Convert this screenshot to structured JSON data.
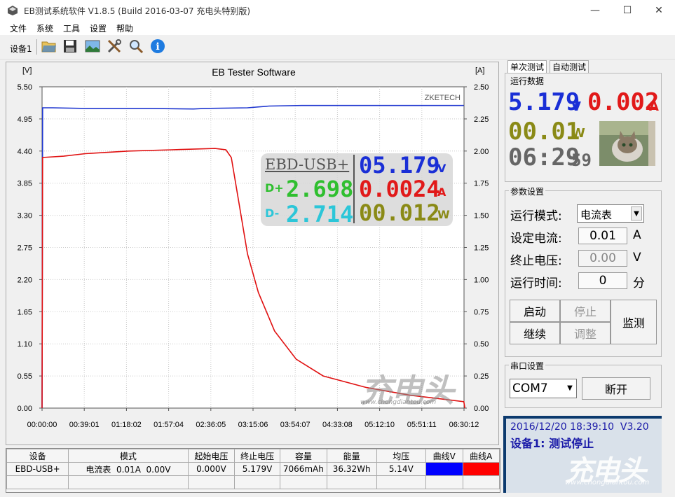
{
  "window": {
    "title": "EB测试系统软件 V1.8.5 (Build 2016-03-07 充电头特别版)",
    "min": "—",
    "max": "☐",
    "close": "✕"
  },
  "menu": [
    "文件",
    "系统",
    "工具",
    "设置",
    "帮助"
  ],
  "toolbar": {
    "device_label": "设备1",
    "icons": [
      "open-folder-icon",
      "save-icon",
      "image-icon",
      "tools-icon",
      "search-icon",
      "info-icon"
    ]
  },
  "colors": {
    "voltage": "#1f37d0",
    "current": "#e01010",
    "lcd_blue": "#1a2fd6",
    "lcd_red": "#e11919",
    "lcd_olive": "#8a8a16",
    "lcd_gray": "#666666",
    "lcd_green": "#2fbf2f",
    "lcd_cyan": "#2cc6d8"
  },
  "chart_data": {
    "type": "line",
    "title": "EB Tester Software",
    "corner_label": "ZKETECH",
    "left_unit": "[V]",
    "right_unit": "[A]",
    "y_left_ticks": [
      "5.50",
      "4.95",
      "4.40",
      "3.85",
      "3.30",
      "2.75",
      "2.20",
      "1.65",
      "1.10",
      "0.55",
      "0.00"
    ],
    "y_right_ticks": [
      "2.50",
      "2.25",
      "2.00",
      "1.75",
      "1.50",
      "1.25",
      "1.00",
      "0.75",
      "0.50",
      "0.25",
      "0.00"
    ],
    "x_ticks": [
      "00:00:00",
      "00:39:01",
      "01:18:02",
      "01:57:04",
      "02:36:05",
      "03:15:06",
      "03:54:07",
      "04:33:08",
      "05:12:10",
      "05:51:11",
      "06:30:12"
    ],
    "ylim_left": [
      0,
      5.5
    ],
    "ylim_right": [
      0,
      2.5
    ],
    "x_range_minutes": [
      0,
      390.2
    ],
    "grid": true,
    "series": [
      {
        "axis": "left",
        "color": "#1f37d0",
        "points": [
          [
            0,
            0
          ],
          [
            0.5,
            5.14
          ],
          [
            10,
            5.14
          ],
          [
            40,
            5.13
          ],
          [
            60,
            5.13
          ],
          [
            100,
            5.13
          ],
          [
            140,
            5.12
          ],
          [
            150,
            5.13
          ],
          [
            190,
            5.14
          ],
          [
            210,
            5.17
          ],
          [
            240,
            5.18
          ],
          [
            300,
            5.18
          ],
          [
            390,
            5.18
          ]
        ]
      },
      {
        "axis": "right",
        "color": "#e01010",
        "points": [
          [
            0,
            0
          ],
          [
            0.5,
            1.95
          ],
          [
            20,
            1.96
          ],
          [
            40,
            1.98
          ],
          [
            80,
            2.0
          ],
          [
            120,
            2.01
          ],
          [
            160,
            2.02
          ],
          [
            170,
            2.01
          ],
          [
            175,
            1.95
          ],
          [
            182,
            1.6
          ],
          [
            190,
            1.2
          ],
          [
            200,
            0.9
          ],
          [
            215,
            0.6
          ],
          [
            235,
            0.38
          ],
          [
            260,
            0.25
          ],
          [
            300,
            0.16
          ],
          [
            340,
            0.1
          ],
          [
            370,
            0.07
          ],
          [
            390,
            0.05
          ],
          [
            391,
            0
          ]
        ]
      }
    ]
  },
  "overlay": {
    "device": "EBD-USB+",
    "voltage": "05.179",
    "voltage_unit": "V",
    "current": "0.0024",
    "current_unit": "A",
    "power": "00.012",
    "power_unit": "W",
    "dplus_label": "D+",
    "dplus": "2.698",
    "dminus_label": "D-",
    "dminus": "2.714"
  },
  "watermark": {
    "text": "充电头",
    "url": "www.chongdiantou.com"
  },
  "table": {
    "headers": [
      "设备",
      "模式",
      "起始电压",
      "终止电压",
      "容量",
      "能量",
      "均压",
      "曲线V",
      "曲线A"
    ],
    "row": [
      "EBD-USB+",
      "电流表  0.01A  0.00V",
      "0.000V",
      "5.179V",
      "7066mAh",
      "36.32Wh",
      "5.14V",
      "",
      ""
    ]
  },
  "right": {
    "tabs": [
      "单次测试",
      "自动测试"
    ],
    "run_data_title": "运行数据",
    "lcd_voltage": "5.179",
    "lcd_voltage_unit": "V",
    "lcd_current": "0.002",
    "lcd_current_unit": "A",
    "lcd_power": "00.01",
    "lcd_power_unit": "W",
    "lcd_time": "06:29",
    "lcd_seconds": "59",
    "params_title": "参数设置",
    "mode_label": "运行模式:",
    "mode_value": "电流表",
    "set_current_label": "设定电流:",
    "set_current_value": "0.01",
    "set_current_unit": "A",
    "stop_voltage_label": "终止电压:",
    "stop_voltage_value": "0.00",
    "stop_voltage_unit": "V",
    "run_time_label": "运行时间:",
    "run_time_value": "0",
    "run_time_unit": "分",
    "btn_start": "启动",
    "btn_stop": "停止",
    "btn_continue": "继续",
    "btn_adjust": "调整",
    "btn_monitor": "监测",
    "serial_title": "串口设置",
    "port": "COM7",
    "btn_disconnect": "断开",
    "status_line1": "2016/12/20 18:39:10  V3.20",
    "status_line2": "设备1: 测试停止"
  }
}
